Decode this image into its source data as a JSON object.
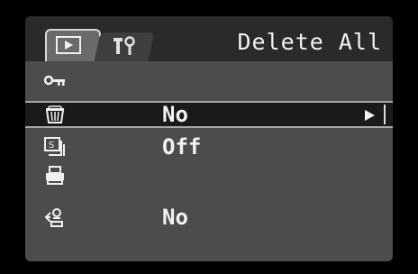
{
  "header": {
    "title": "Delete All",
    "tabs": [
      "playback-tab",
      "setup-tab"
    ]
  },
  "menu": {
    "rows": [
      {
        "icon": "key-icon",
        "value": ""
      },
      {
        "icon": "trash-icon",
        "value": "No",
        "selected": true
      },
      {
        "icon": "slideshow-icon",
        "value": "Off"
      },
      {
        "icon": "printer-icon",
        "value": ""
      },
      {
        "icon": "transfer-icon",
        "value": "No"
      }
    ]
  },
  "colors": {
    "screen_bg": "#4c4c4c",
    "selected_bg": "#1a1a1a",
    "text": "#f2f2f2"
  }
}
